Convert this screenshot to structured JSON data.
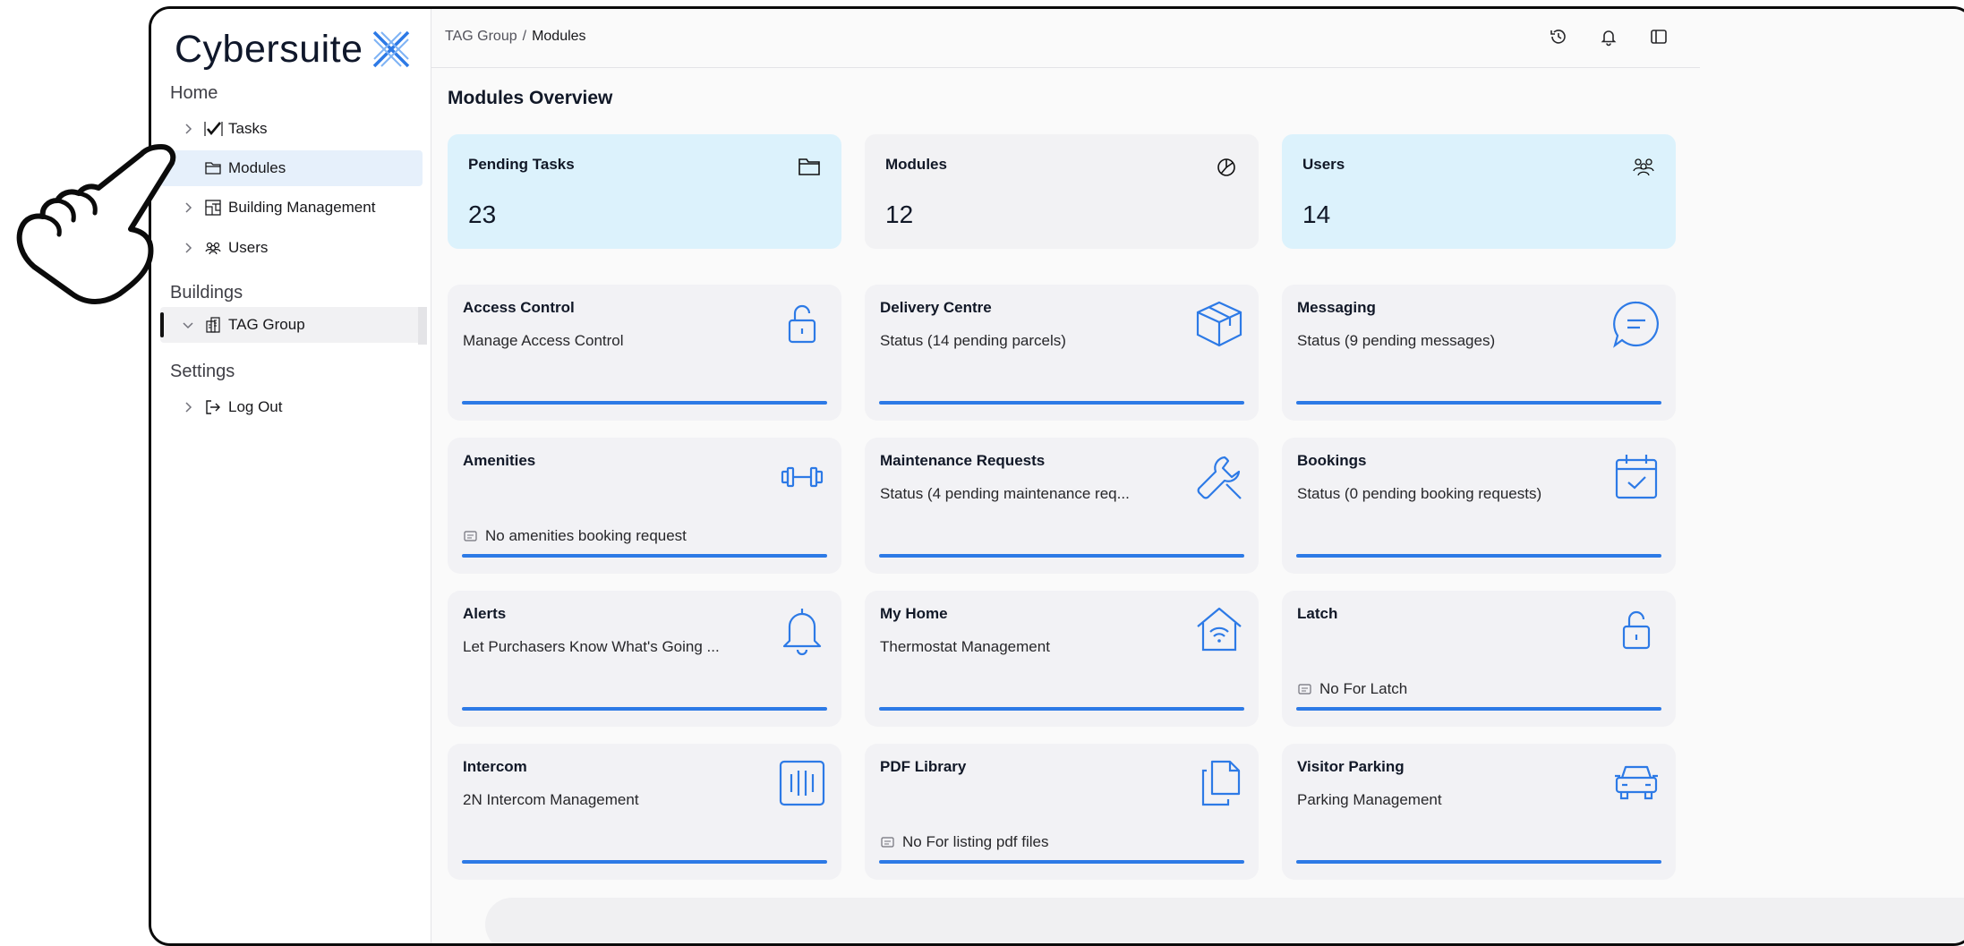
{
  "brand": {
    "name": "Cybersuite"
  },
  "sidebar": {
    "home_label": "Home",
    "home_items": [
      {
        "label": "Tasks"
      },
      {
        "label": "Modules"
      },
      {
        "label": "Building Management"
      },
      {
        "label": "Users"
      }
    ],
    "buildings_label": "Buildings",
    "building_items": [
      {
        "label": "TAG Group"
      }
    ],
    "settings_label": "Settings",
    "settings_items": [
      {
        "label": "Log Out"
      }
    ]
  },
  "breadcrumb": {
    "root": "TAG Group",
    "separator": "/",
    "current": "Modules"
  },
  "page_title": "Modules Overview",
  "stats": [
    {
      "title": "Pending Tasks",
      "value": "23",
      "icon": "folder-icon"
    },
    {
      "title": "Modules",
      "value": "12",
      "icon": "pie-chart-icon"
    },
    {
      "title": "Users",
      "value": "14",
      "icon": "users-icon"
    }
  ],
  "modules": [
    {
      "title": "Access Control",
      "subtitle": "Manage Access Control",
      "note": "",
      "icon": "unlock-icon"
    },
    {
      "title": "Delivery Centre",
      "subtitle": "Status (14 pending parcels)",
      "note": "",
      "icon": "package-icon"
    },
    {
      "title": "Messaging",
      "subtitle": "Status (9 pending messages)",
      "note": "",
      "icon": "message-icon"
    },
    {
      "title": "Amenities",
      "subtitle": "",
      "note": "No amenities booking request",
      "icon": "dumbbell-icon"
    },
    {
      "title": "Maintenance Requests",
      "subtitle": "Status (4 pending maintenance req...",
      "note": "",
      "icon": "wrench-icon"
    },
    {
      "title": "Bookings",
      "subtitle": "Status (0 pending booking requests)",
      "note": "",
      "icon": "calendar-check-icon"
    },
    {
      "title": "Alerts",
      "subtitle": "Let Purchasers Know What's Going ...",
      "note": "",
      "icon": "bell-icon"
    },
    {
      "title": "My Home",
      "subtitle": "Thermostat Management",
      "note": "",
      "icon": "home-wifi-icon"
    },
    {
      "title": "Latch",
      "subtitle": "",
      "note": "No For Latch",
      "icon": "unlock-icon"
    },
    {
      "title": "Intercom",
      "subtitle": "2N Intercom Management",
      "note": "",
      "icon": "intercom-icon"
    },
    {
      "title": "PDF Library",
      "subtitle": "",
      "note": "No For listing pdf files",
      "icon": "files-icon"
    },
    {
      "title": "Visitor Parking",
      "subtitle": "Parking Management",
      "note": "",
      "icon": "car-icon"
    }
  ],
  "colors": {
    "accent": "#2d7ae6",
    "stat_highlight": "#dcf2fc",
    "card_bg": "#f2f2f5",
    "active_nav": "#e6f0fb"
  }
}
